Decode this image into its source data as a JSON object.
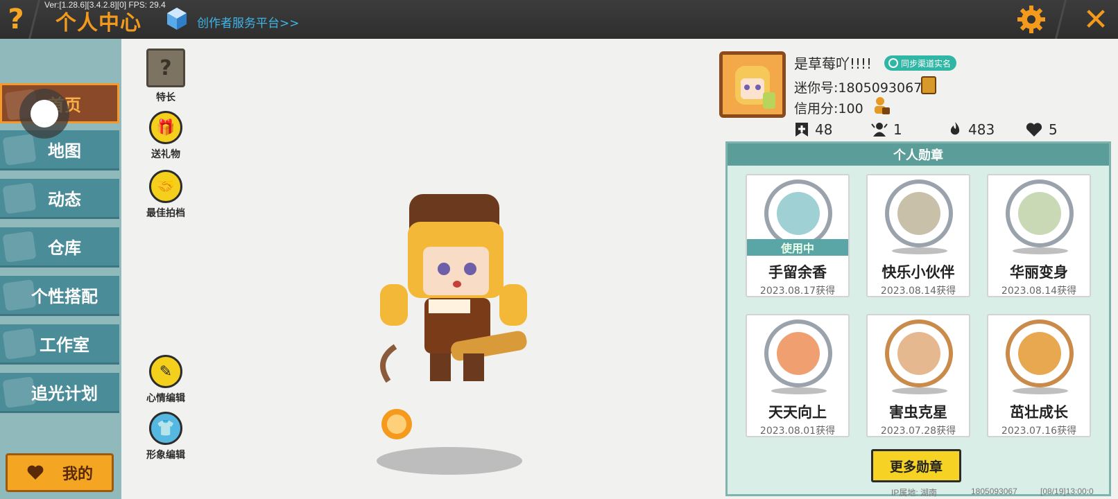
{
  "header": {
    "version_text": "Ver:[1.28.6][3.4.2.8][0] FPS: 29.4",
    "title": "个人中心",
    "creator_link": "创作者服务平台>>",
    "help_label": "?",
    "close_label": "✕"
  },
  "sidebar": {
    "items": [
      {
        "label": "首页",
        "active": true
      },
      {
        "label": "地图"
      },
      {
        "label": "动态"
      },
      {
        "label": "仓库"
      },
      {
        "label": "个性搭配"
      },
      {
        "label": "工作室"
      },
      {
        "label": "追光计划"
      }
    ],
    "mine_label": "我的",
    "mine_icon": "heart-icon"
  },
  "actions": {
    "skill": "特长",
    "gift": "送礼物",
    "best_partner": "最佳拍档",
    "mood_edit": "心情编辑",
    "appearance_edit": "形象编辑"
  },
  "profile": {
    "name": "是草莓吖!!!!",
    "sync_button": "同步渠道实名",
    "mini_id": "迷你号:1805093067",
    "credit": "信用分:100",
    "stats": {
      "likes": "48",
      "fans": "1",
      "popularity": "483",
      "hearts": "5"
    }
  },
  "medals": {
    "title": "个人勋章",
    "in_use_label": "使用中",
    "items": [
      {
        "name": "手留余香",
        "date": "2023.08.17获得",
        "in_use": true,
        "color": "#9fd0d3"
      },
      {
        "name": "快乐小伙伴",
        "date": "2023.08.14获得",
        "color": "#c8c0a8"
      },
      {
        "name": "华丽变身",
        "date": "2023.08.14获得",
        "color": "#c9d8b5"
      },
      {
        "name": "天天向上",
        "date": "2023.08.01获得",
        "color": "#f0a070"
      },
      {
        "name": "害虫克星",
        "date": "2023.07.28获得",
        "color": "#e6b890"
      },
      {
        "name": "茁壮成长",
        "date": "2023.07.16获得",
        "color": "#e8a850"
      }
    ],
    "more_button": "更多勋章"
  },
  "footer": {
    "ip_location": "IP属地: 湖南",
    "mini_id": "1805093067",
    "datetime": "[08/19]13:00:0"
  },
  "colors": {
    "accent_orange": "#f39a1c",
    "nav_teal": "#4a8c98",
    "panel_mint": "#d8eee6",
    "button_yellow": "#f5d224"
  }
}
